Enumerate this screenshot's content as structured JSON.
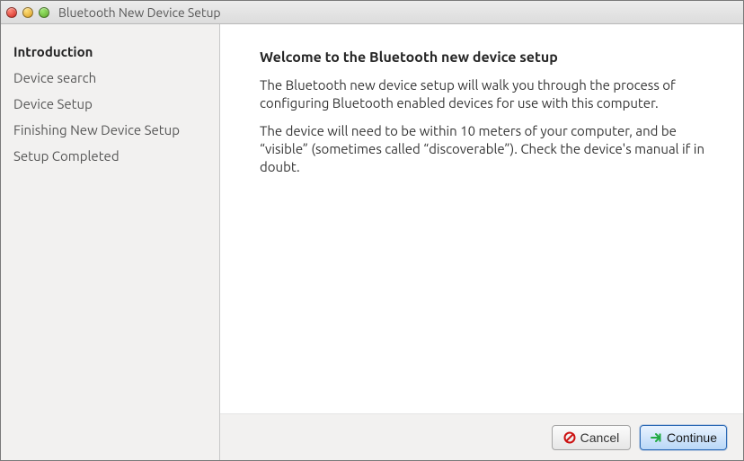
{
  "titlebar": {
    "title": "Bluetooth New Device Setup"
  },
  "sidebar": {
    "steps": [
      {
        "label": "Introduction",
        "current": true
      },
      {
        "label": "Device search",
        "current": false
      },
      {
        "label": "Device Setup",
        "current": false
      },
      {
        "label": "Finishing New Device Setup",
        "current": false
      },
      {
        "label": "Setup Completed",
        "current": false
      }
    ]
  },
  "main": {
    "heading": "Welcome to the Bluetooth new device setup",
    "paragraphs": [
      "The Bluetooth new device setup will walk you through the process of configuring Bluetooth enabled devices for use with this computer.",
      "The device will need to be within 10 meters of your computer, and be “visible” (sometimes called “discoverable”). Check the device's manual if in doubt."
    ]
  },
  "buttons": {
    "cancel": "Cancel",
    "continue": "Continue"
  }
}
